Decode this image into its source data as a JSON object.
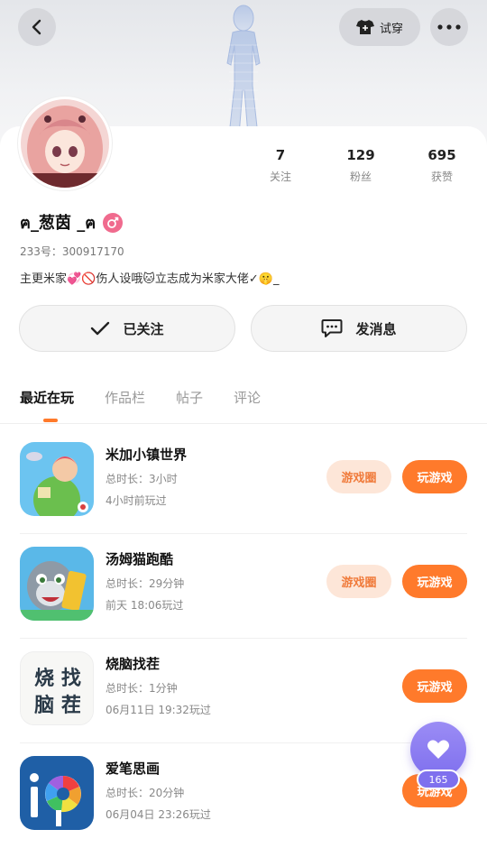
{
  "header": {
    "try_on_label": "试穿"
  },
  "stats": [
    {
      "value": "7",
      "label": "关注"
    },
    {
      "value": "129",
      "label": "粉丝"
    },
    {
      "value": "695",
      "label": "获赞"
    }
  ],
  "profile": {
    "nickname": "ฅ_葱茵 _ฅ",
    "uid": "233号：300917170",
    "bio": "主更米家💞🚫伤人设哦🐱立志成为米家大佬✓🤫_"
  },
  "actions": {
    "follow_label": "已关注",
    "message_label": "发消息"
  },
  "tabs": [
    "最近在玩",
    "作品栏",
    "帖子",
    "评论"
  ],
  "games": [
    {
      "name": "米加小镇世界",
      "duration": "总时长：3小时",
      "last_played": "4小时前玩过",
      "has_circle": true,
      "circle_label": "游戏圈",
      "play_label": "玩游戏"
    },
    {
      "name": "汤姆猫跑酷",
      "duration": "总时长：29分钟",
      "last_played": "前天 18:06玩过",
      "has_circle": true,
      "circle_label": "游戏圈",
      "play_label": "玩游戏"
    },
    {
      "name": "烧脑找茬",
      "duration": "总时长：1分钟",
      "last_played": "06月11日 19:32玩过",
      "has_circle": false,
      "play_label": "玩游戏",
      "icon_text": "烧脑找茬"
    },
    {
      "name": "爱笔思画",
      "duration": "总时长：20分钟",
      "last_played": "06月04日 23:26玩过",
      "has_circle": false,
      "play_label": "玩游戏"
    }
  ],
  "fab": {
    "count": "165"
  },
  "colors": {
    "accent": "#ff7a2b",
    "accent_light": "#fde6d8",
    "fab": "#8b7cf2",
    "gender": "#f06b8e"
  }
}
